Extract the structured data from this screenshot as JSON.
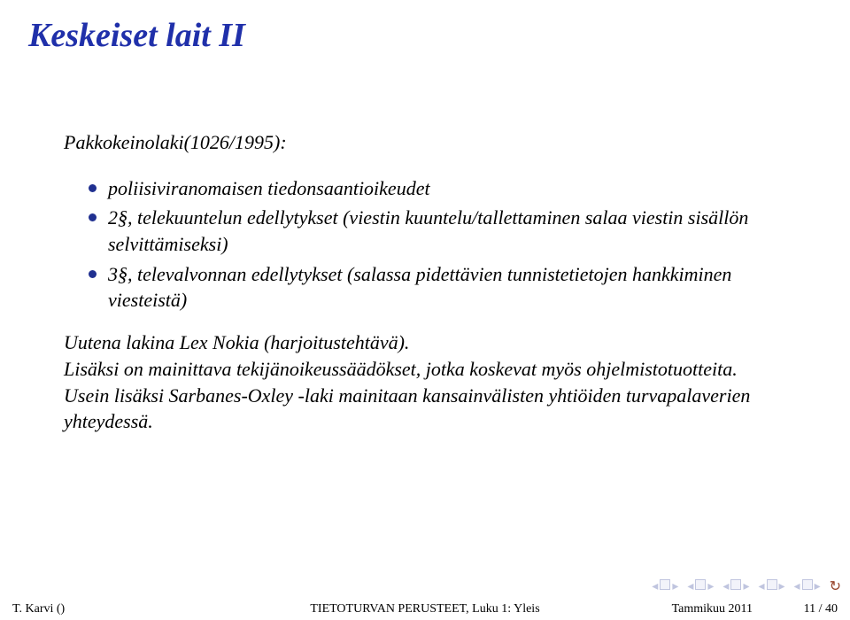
{
  "title": "Keskeiset lait II",
  "subtitle": "Pakkokeinolaki(1026/1995):",
  "bullets": [
    "poliisiviranomaisen tiedonsaantioikeudet",
    "2§, telekuuntelun edellytykset (viestin kuuntelu/tallettaminen salaa viestin sisällön selvittämiseksi)",
    "3§, televalvonnan edellytykset (salassa pidettävien tunnistetietojen hankkiminen viesteistä)"
  ],
  "body": "Uutena lakina Lex Nokia (harjoitustehtävä).\nLisäksi on mainittava tekijänoikeussäädökset, jotka koskevat myös ohjelmistotuotteita. Usein lisäksi Sarbanes-Oxley -laki mainitaan kansainvälisten yhtiöiden turvapalaverien yhteydessä.",
  "footer": {
    "author": "T. Karvi ()",
    "course": "TIETOTURVAN PERUSTEET, Luku 1: Yleis",
    "date": "Tammikuu 2011",
    "page": "11 / 40"
  },
  "nav": {
    "prev_slide": "◂",
    "next_slide": "▸",
    "prev_sec": "◂",
    "next_sec": "▸",
    "loop": "↻"
  }
}
